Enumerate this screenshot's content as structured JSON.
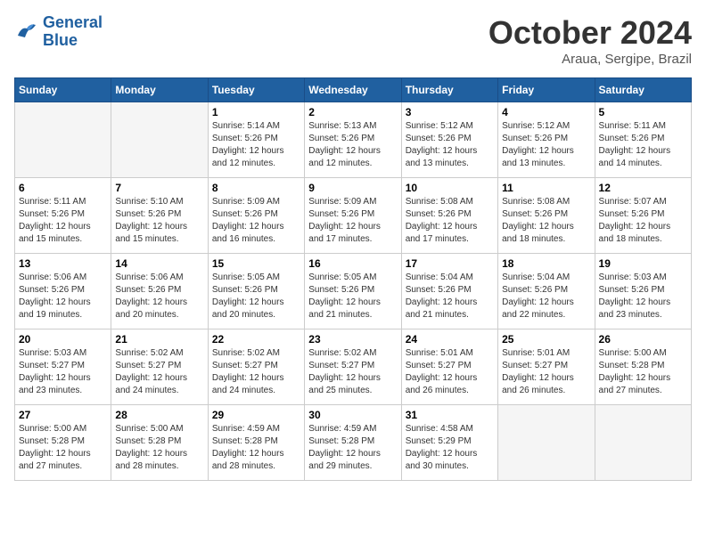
{
  "logo": {
    "line1": "General",
    "line2": "Blue"
  },
  "title": {
    "month_year": "October 2024",
    "location": "Araua, Sergipe, Brazil"
  },
  "days_header": [
    "Sunday",
    "Monday",
    "Tuesday",
    "Wednesday",
    "Thursday",
    "Friday",
    "Saturday"
  ],
  "weeks": [
    [
      {
        "day": "",
        "empty": true
      },
      {
        "day": "",
        "empty": true
      },
      {
        "day": "1",
        "sunrise": "5:14 AM",
        "sunset": "5:26 PM",
        "daylight": "12 hours and 12 minutes."
      },
      {
        "day": "2",
        "sunrise": "5:13 AM",
        "sunset": "5:26 PM",
        "daylight": "12 hours and 12 minutes."
      },
      {
        "day": "3",
        "sunrise": "5:12 AM",
        "sunset": "5:26 PM",
        "daylight": "12 hours and 13 minutes."
      },
      {
        "day": "4",
        "sunrise": "5:12 AM",
        "sunset": "5:26 PM",
        "daylight": "12 hours and 13 minutes."
      },
      {
        "day": "5",
        "sunrise": "5:11 AM",
        "sunset": "5:26 PM",
        "daylight": "12 hours and 14 minutes."
      }
    ],
    [
      {
        "day": "6",
        "sunrise": "5:11 AM",
        "sunset": "5:26 PM",
        "daylight": "12 hours and 15 minutes."
      },
      {
        "day": "7",
        "sunrise": "5:10 AM",
        "sunset": "5:26 PM",
        "daylight": "12 hours and 15 minutes."
      },
      {
        "day": "8",
        "sunrise": "5:09 AM",
        "sunset": "5:26 PM",
        "daylight": "12 hours and 16 minutes."
      },
      {
        "day": "9",
        "sunrise": "5:09 AM",
        "sunset": "5:26 PM",
        "daylight": "12 hours and 17 minutes."
      },
      {
        "day": "10",
        "sunrise": "5:08 AM",
        "sunset": "5:26 PM",
        "daylight": "12 hours and 17 minutes."
      },
      {
        "day": "11",
        "sunrise": "5:08 AM",
        "sunset": "5:26 PM",
        "daylight": "12 hours and 18 minutes."
      },
      {
        "day": "12",
        "sunrise": "5:07 AM",
        "sunset": "5:26 PM",
        "daylight": "12 hours and 18 minutes."
      }
    ],
    [
      {
        "day": "13",
        "sunrise": "5:06 AM",
        "sunset": "5:26 PM",
        "daylight": "12 hours and 19 minutes."
      },
      {
        "day": "14",
        "sunrise": "5:06 AM",
        "sunset": "5:26 PM",
        "daylight": "12 hours and 20 minutes."
      },
      {
        "day": "15",
        "sunrise": "5:05 AM",
        "sunset": "5:26 PM",
        "daylight": "12 hours and 20 minutes."
      },
      {
        "day": "16",
        "sunrise": "5:05 AM",
        "sunset": "5:26 PM",
        "daylight": "12 hours and 21 minutes."
      },
      {
        "day": "17",
        "sunrise": "5:04 AM",
        "sunset": "5:26 PM",
        "daylight": "12 hours and 21 minutes."
      },
      {
        "day": "18",
        "sunrise": "5:04 AM",
        "sunset": "5:26 PM",
        "daylight": "12 hours and 22 minutes."
      },
      {
        "day": "19",
        "sunrise": "5:03 AM",
        "sunset": "5:26 PM",
        "daylight": "12 hours and 23 minutes."
      }
    ],
    [
      {
        "day": "20",
        "sunrise": "5:03 AM",
        "sunset": "5:27 PM",
        "daylight": "12 hours and 23 minutes."
      },
      {
        "day": "21",
        "sunrise": "5:02 AM",
        "sunset": "5:27 PM",
        "daylight": "12 hours and 24 minutes."
      },
      {
        "day": "22",
        "sunrise": "5:02 AM",
        "sunset": "5:27 PM",
        "daylight": "12 hours and 24 minutes."
      },
      {
        "day": "23",
        "sunrise": "5:02 AM",
        "sunset": "5:27 PM",
        "daylight": "12 hours and 25 minutes."
      },
      {
        "day": "24",
        "sunrise": "5:01 AM",
        "sunset": "5:27 PM",
        "daylight": "12 hours and 26 minutes."
      },
      {
        "day": "25",
        "sunrise": "5:01 AM",
        "sunset": "5:27 PM",
        "daylight": "12 hours and 26 minutes."
      },
      {
        "day": "26",
        "sunrise": "5:00 AM",
        "sunset": "5:28 PM",
        "daylight": "12 hours and 27 minutes."
      }
    ],
    [
      {
        "day": "27",
        "sunrise": "5:00 AM",
        "sunset": "5:28 PM",
        "daylight": "12 hours and 27 minutes."
      },
      {
        "day": "28",
        "sunrise": "5:00 AM",
        "sunset": "5:28 PM",
        "daylight": "12 hours and 28 minutes."
      },
      {
        "day": "29",
        "sunrise": "4:59 AM",
        "sunset": "5:28 PM",
        "daylight": "12 hours and 28 minutes."
      },
      {
        "day": "30",
        "sunrise": "4:59 AM",
        "sunset": "5:28 PM",
        "daylight": "12 hours and 29 minutes."
      },
      {
        "day": "31",
        "sunrise": "4:58 AM",
        "sunset": "5:29 PM",
        "daylight": "12 hours and 30 minutes."
      },
      {
        "day": "",
        "empty": true
      },
      {
        "day": "",
        "empty": true
      }
    ]
  ],
  "labels": {
    "sunrise_prefix": "Sunrise: ",
    "sunset_prefix": "Sunset: ",
    "daylight_prefix": "Daylight: "
  }
}
